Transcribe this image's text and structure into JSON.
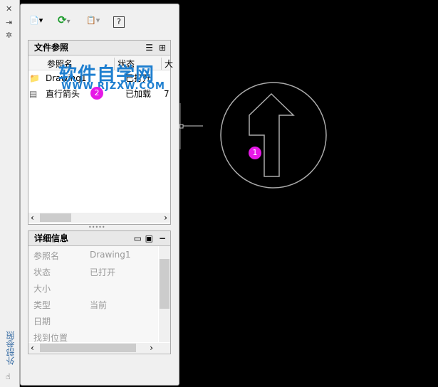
{
  "panel": {
    "title_vertical": "外部参照"
  },
  "file_refs": {
    "title": "文件参照",
    "columns": [
      "参照名",
      "状态",
      "大"
    ],
    "rows": [
      {
        "name": "Drawing1",
        "status": "已打开",
        "size": ""
      },
      {
        "name": "直行箭头",
        "status": "已加载",
        "size": "7"
      }
    ]
  },
  "details": {
    "title": "详细信息",
    "fields": [
      {
        "label": "参照名",
        "value": "Drawing1"
      },
      {
        "label": "状态",
        "value": "已打开"
      },
      {
        "label": "大小",
        "value": ""
      },
      {
        "label": "类型",
        "value": "当前"
      },
      {
        "label": "日期",
        "value": ""
      },
      {
        "label": "找到位置",
        "value": ""
      }
    ]
  },
  "watermark": {
    "title": "软件自学网",
    "url": "WWW.RJZXW.COM"
  },
  "badges": {
    "b1": "1",
    "b2": "2"
  }
}
